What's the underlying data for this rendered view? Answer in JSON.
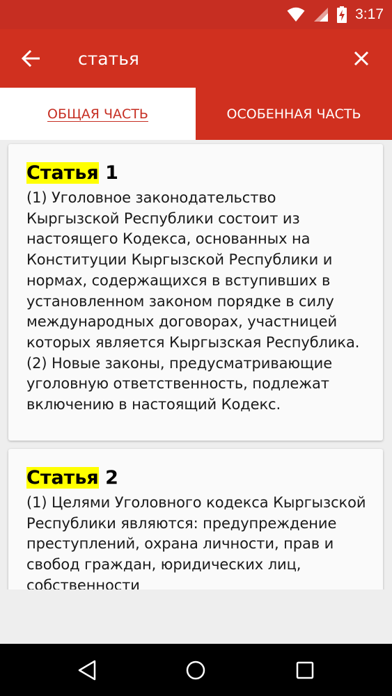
{
  "status_bar": {
    "time": "3:17"
  },
  "search": {
    "query": "статья"
  },
  "tabs": [
    {
      "label": "ОБЩАЯ ЧАСТЬ"
    },
    {
      "label": "ОСОБЕННАЯ ЧАСТЬ"
    }
  ],
  "articles": [
    {
      "title_word": "Статья",
      "number": "1",
      "text": "(1) Уголовное законодательство Кыргызской Республики состоит из настоящего Кодекса, основанных на Конституции Кыргызской Республики и нормах, содержащихся в вступивших в установленном законом порядке в силу международных договорах, участницей которых является Кыргызская Республика. (2) Новые законы, предусматривающие уголовную ответственность, подлежат включению в настоящий Кодекс."
    },
    {
      "title_word": "Статья",
      "number": "2",
      "text": "(1) Целями Уголовного кодекса Кыргызской Республики являются: предупреждение преступлений, охрана личности, прав и свобод граждан, юридических лиц, собственности"
    }
  ],
  "colors": {
    "primary": "#d0301f",
    "status_bar": "#c62e22",
    "highlight": "#ffff00"
  },
  "icons": [
    "wifi-icon",
    "signal-icon",
    "battery-charging-icon",
    "back-arrow-icon",
    "close-icon",
    "nav-back-icon",
    "nav-home-icon",
    "nav-recents-icon"
  ]
}
